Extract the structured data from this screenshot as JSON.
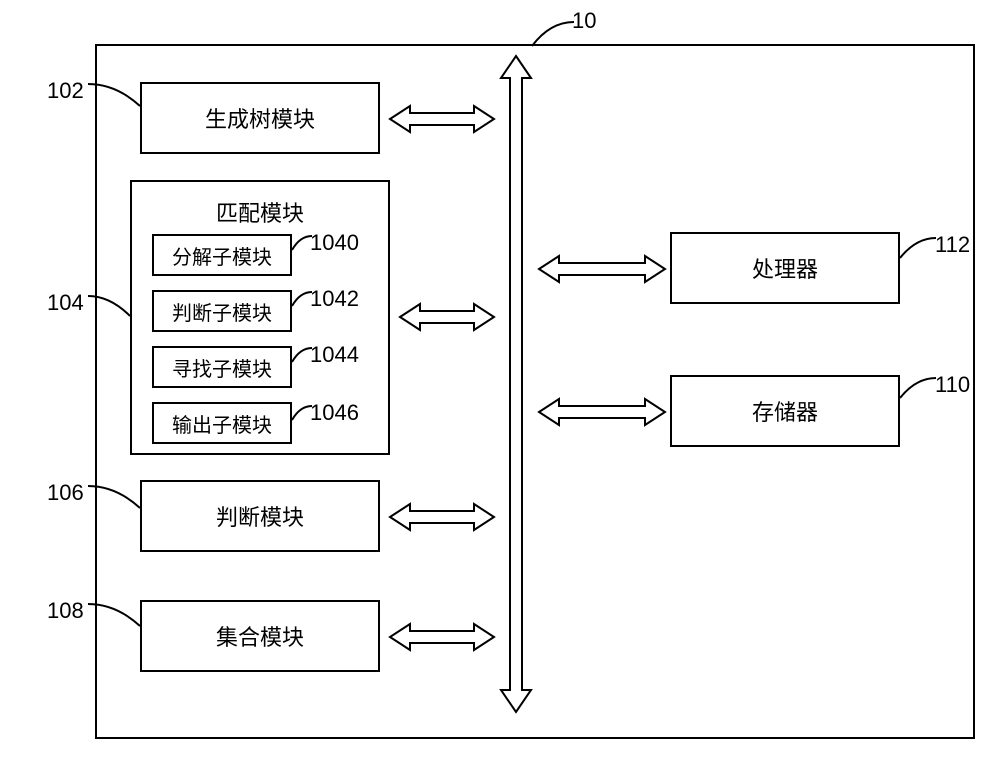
{
  "labels": {
    "outer": "10",
    "m102": "102",
    "m104": "104",
    "m106": "106",
    "m108": "108",
    "m110": "110",
    "m112": "112",
    "s1040": "1040",
    "s1042": "1042",
    "s1044": "1044",
    "s1046": "1046"
  },
  "boxes": {
    "spanning_tree": "生成树模块",
    "matching": "匹配模块",
    "decompose_sub": "分解子模块",
    "judge_sub": "判断子模块",
    "search_sub": "寻找子模块",
    "output_sub": "输出子模块",
    "judgment": "判断模块",
    "collection": "集合模块",
    "processor": "处理器",
    "memory": "存储器"
  }
}
